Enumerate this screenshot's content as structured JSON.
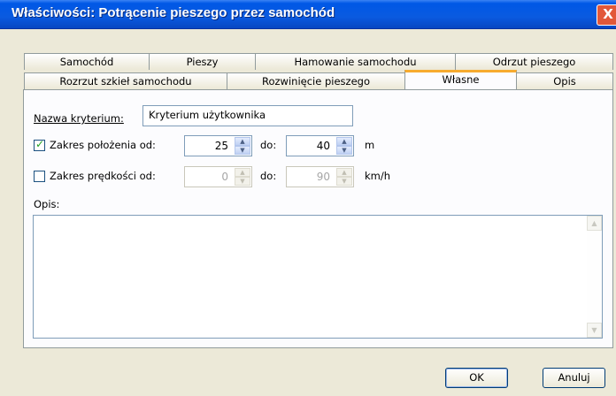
{
  "window": {
    "title": "Właściwości: Potrącenie pieszego przez samochód",
    "close_glyph": "X"
  },
  "tabs": {
    "row1": [
      "Samochód",
      "Pieszy",
      "Hamowanie samochodu",
      "Odrzut pieszego"
    ],
    "row2": [
      "Rozrzut szkieł samochodu",
      "Rozwinięcie pieszego",
      "Własne",
      "Opis"
    ],
    "active": "Własne"
  },
  "form": {
    "criterion_label": "Nazwa kryterium:",
    "criterion_value": "Kryterium użytkownika",
    "position_range": {
      "label": "Zakres położenia od:",
      "checked": true,
      "from": "25",
      "to_label": "do:",
      "to": "40",
      "unit": "m"
    },
    "speed_range": {
      "label": "Zakres prędkości od:",
      "checked": false,
      "from": "0",
      "to_label": "do:",
      "to": "90",
      "unit": "km/h"
    },
    "description_label": "Opis:",
    "description_value": ""
  },
  "buttons": {
    "ok": "OK",
    "cancel": "Anuluj"
  },
  "colors": {
    "titlebar": "#0058e6",
    "tab_highlight": "#f7ab2f",
    "dialog_bg": "#ece9d8"
  }
}
